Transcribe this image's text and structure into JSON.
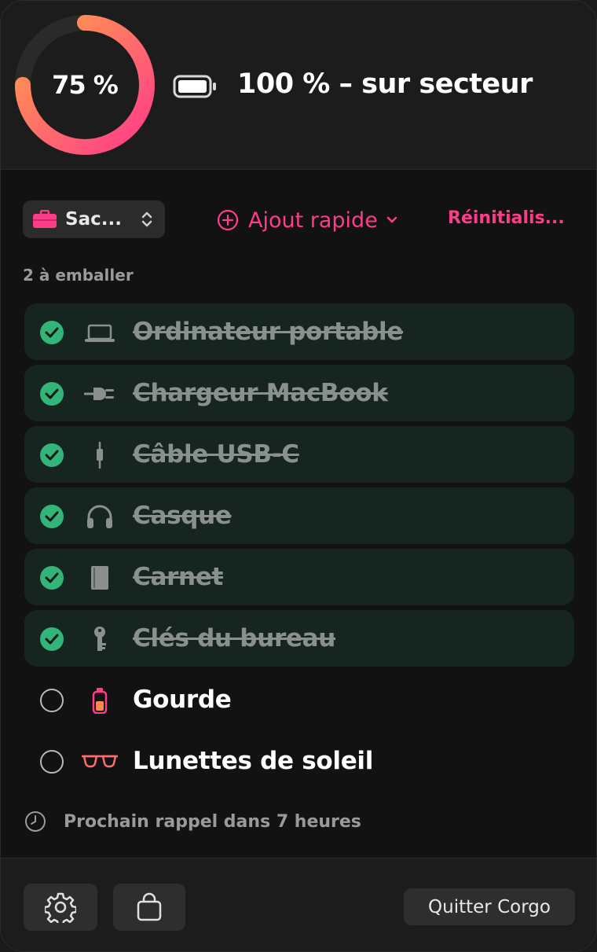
{
  "header": {
    "charge_percent": 75,
    "ring_label": "75 %",
    "battery_status": "100 % – sur secteur",
    "ring_colors": {
      "start": "#ff3c8a",
      "end": "#ffa04a",
      "track": "#2a2a2a"
    }
  },
  "toolbar": {
    "bag_name": "Sac...",
    "bag_icon": "briefcase-icon",
    "quick_add_label": "Ajout rapide",
    "reset_label": "Réinitialis..."
  },
  "list": {
    "count_label": "2 à emballer",
    "items": [
      {
        "label": "Ordinateur portable",
        "icon": "laptop-icon",
        "packed": true
      },
      {
        "label": "Chargeur MacBook",
        "icon": "plug-icon",
        "packed": true
      },
      {
        "label": "Câble USB-C",
        "icon": "cable-icon",
        "packed": true
      },
      {
        "label": "Casque",
        "icon": "headphones-icon",
        "packed": true
      },
      {
        "label": "Carnet",
        "icon": "book-icon",
        "packed": true
      },
      {
        "label": "Clés du bureau",
        "icon": "key-icon",
        "packed": true
      },
      {
        "label": "Gourde",
        "icon": "bottle-icon",
        "packed": false
      },
      {
        "label": "Lunettes de soleil",
        "icon": "sunglasses-icon",
        "packed": false
      }
    ]
  },
  "reminder": {
    "text": "Prochain rappel dans 7 heures"
  },
  "footer": {
    "quit_label": "Quitter Corgo"
  },
  "colors": {
    "accent": "#ff3c8a",
    "packed_green": "#33b57a",
    "packed_bg": "#172520"
  }
}
